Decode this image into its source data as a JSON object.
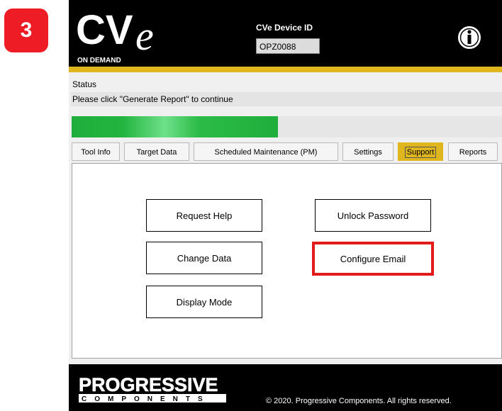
{
  "step_badge": "3",
  "header": {
    "logo_text": "CVe",
    "logo_subtext": "ON DEMAND",
    "device_id_label": "CVe Device ID",
    "device_id_value": "OPZ0088",
    "info_icon": "info-icon"
  },
  "status": {
    "label": "Status",
    "message": "Please click \"Generate Report\" to continue",
    "progress": 0.48,
    "progress_color": "#23b43f"
  },
  "tabs": [
    {
      "label": "Tool Info",
      "active": false
    },
    {
      "label": "Target Data",
      "active": false
    },
    {
      "label": "Scheduled Maintenance (PM)",
      "active": false
    },
    {
      "label": "Settings",
      "active": false
    },
    {
      "label": "Support",
      "active": true
    },
    {
      "label": "Reports",
      "active": false
    }
  ],
  "support_panel": {
    "request_help": "Request Help",
    "unlock_password": "Unlock Password",
    "change_data": "Change Data",
    "configure_email": "Configure Email",
    "display_mode": "Display Mode",
    "highlighted": "Configure Email",
    "highlight_color": "#e11b1b"
  },
  "footer": {
    "brand_top": "PROGRESSIVE",
    "brand_bottom": "COMPONENTS",
    "copyright": "© 2020. Progressive Components. All rights reserved."
  },
  "colors": {
    "accent_gold": "#e0b61f",
    "badge_red": "#ee1c25"
  }
}
